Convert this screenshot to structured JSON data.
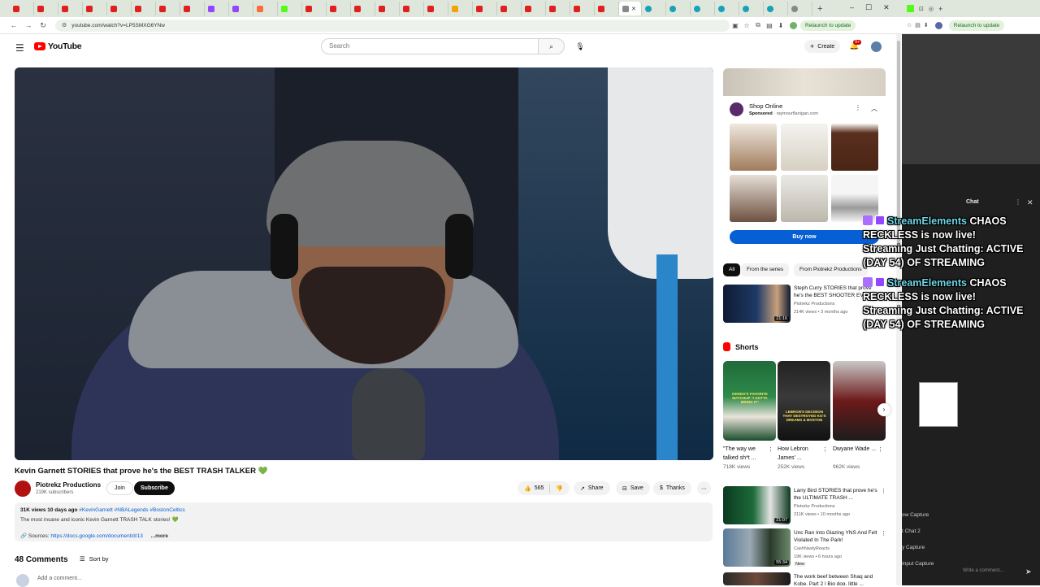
{
  "browser": {
    "url": "youtube.com/watch?v=LP5SMXG6YNw",
    "relaunch": "Relaunch to update",
    "tab_count": 25
  },
  "youtube": {
    "logo": "YouTube",
    "search_placeholder": "Search",
    "create": "Create",
    "notif_badge": "9+"
  },
  "video": {
    "title": "Kevin Garnett STORIES that prove he's the BEST TRASH TALKER",
    "channel": "Piotrekz Productions",
    "subscribers": "219K subscribers",
    "join": "Join",
    "subscribe": "Subscribe",
    "likes": "565",
    "share": "Share",
    "save": "Save",
    "thanks": "Thanks"
  },
  "description": {
    "stats": "31K views  10 days ago",
    "tags": "#KevinGarnett #NBALegends #BostonCeltics",
    "line2": "The most insane and iconic Kevin Garnett TRASH TALK stories!",
    "sources_label": "Sources:",
    "sources_link": "https://docs.google.com/document/d/13",
    "more": "...more"
  },
  "comments": {
    "count": "48 Comments",
    "sort": "Sort by",
    "add": "Add a comment..."
  },
  "ad": {
    "title": "Shop Online",
    "sponsored": "Sponsored",
    "domain": "raymourflanigan.com",
    "buy": "Buy now"
  },
  "chips": [
    "All",
    "From the series",
    "From Piotrekz Productions"
  ],
  "recommended": [
    {
      "title": "Steph Curry STORIES that prove he's the BEST SHOOTER EVER",
      "channel": "Piotrekz Productions",
      "meta": "214K views • 3 months ago",
      "duration": "21:16"
    },
    {
      "title": "Larry Bird STORIES that prove he's the ULTIMATE TRASH ...",
      "channel": "Piotrekz Productions",
      "meta": "211K views • 10 months ago",
      "duration": "21:07"
    },
    {
      "title": "Unc Ran Into Glazing YNS And Felt Violated In The Park!",
      "channel": "CashNastyReacts",
      "meta": "19K views • 6 hours ago",
      "badge": "New",
      "duration": "55:34"
    },
    {
      "title": "The work beef between Shaq and Kobe, Part 2 | Big dog, little ...",
      "channel": "",
      "meta": "",
      "duration": ""
    }
  ],
  "shorts": {
    "heading": "Shorts",
    "items": [
      {
        "title": "\"The way we talked sh*t ...",
        "views": "718K views",
        "caption": "KENDO'S FAVORITE MATCHUP \"I GOTTA BRING IT\""
      },
      {
        "title": "How Lebron James' ...",
        "views": "252K views",
        "caption": "LEBRON'S DECISION THAT DESTROYED KG'S DREAMS & BOSTON"
      },
      {
        "title": "Dwyane Wade ...",
        "views": "962K views",
        "caption": ""
      }
    ]
  },
  "overlay": {
    "messages": [
      {
        "name": "StreamElements",
        "text": "CHAOS RECKLESS is now live! Streaming Just Chatting: ACTIVE (DAY 54) OF STREAMING"
      },
      {
        "name": "StreamElements",
        "text": "CHAOS RECKLESS is now live! Streaming Just Chatting: ACTIVE (DAY 54) OF STREAMING"
      }
    ]
  },
  "right_window": {
    "chat_heading": "Chat",
    "sources": [
      "ow Capture",
      "t Chat 2",
      "y Capture",
      "Input Capture"
    ],
    "chat_placeholder": "Write a comment...",
    "relaunch": "Relaunch to update"
  },
  "colors": {
    "yt_red": "#ff0000",
    "subscribe_bg": "#0f0f0f",
    "buy_blue": "#065fd4",
    "twitch_purple": "#9147ff",
    "tabstrip_bg": "#dfe7dc"
  }
}
